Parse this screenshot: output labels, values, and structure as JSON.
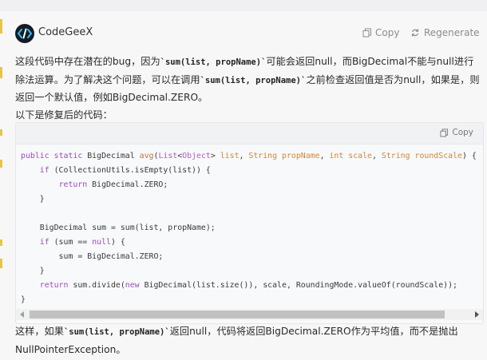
{
  "header": {
    "app_name": "CodeGeeX",
    "logo_icon": "codegeex-logo-icon",
    "copy_label": "Copy",
    "regenerate_label": "Regenerate"
  },
  "answer": {
    "para1_a": "这段代码中存在潜在的bug，因为",
    "para1_code1": "`sum(list, propName)`",
    "para1_b": "可能会返回null，而BigDecimal不能与null进行除法运算。为了解决这个问题，可以在调用",
    "para1_code2": "`sum(list, propName)`",
    "para1_c": "之前检查返回值是否为null，如果是，则返回一个默认值，例如BigDecimal.ZERO。",
    "para2": "以下是修复后的代码："
  },
  "code_block": {
    "copy_label": "Copy",
    "lines": [
      "public static BigDecimal avg(List<Object> list, String propName, int scale, String roundScale) {",
      "    if (CollectionUtils.isEmpty(list)) {",
      "        return BigDecimal.ZERO;",
      "    }",
      "",
      "    BigDecimal sum = sum(list, propName);",
      "    if (sum == null) {",
      "        sum = BigDecimal.ZERO;",
      "    }",
      "    return sum.divide(new BigDecimal(list.size()), scale, RoundingMode.valueOf(roundScale));",
      "}"
    ]
  },
  "after": {
    "a": "这样，如果",
    "code": "`sum(list, propName)`",
    "b": "返回null，代码将返回BigDecimal.ZERO作为平均值，而不是抛出NullPointerException。"
  },
  "colors": {
    "keyword": "#9a4fb8",
    "function": "#b9783f",
    "param": "#d4872f",
    "logo_bg": "#151a23",
    "logo_accent": "#2fb7ea"
  }
}
